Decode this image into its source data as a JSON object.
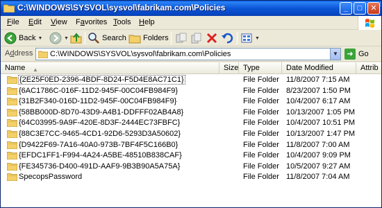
{
  "window": {
    "title": "C:\\WINDOWS\\SYSVOL\\sysvol\\fabrikam.com\\Policies",
    "buttons": {
      "minimize": "_",
      "maximize": "□",
      "close": "✕"
    }
  },
  "menu": {
    "items": [
      {
        "pre": "",
        "key": "F",
        "post": "ile"
      },
      {
        "pre": "",
        "key": "E",
        "post": "dit"
      },
      {
        "pre": "",
        "key": "V",
        "post": "iew"
      },
      {
        "pre": "F",
        "key": "a",
        "post": "vorites"
      },
      {
        "pre": "",
        "key": "T",
        "post": "ools"
      },
      {
        "pre": "",
        "key": "H",
        "post": "elp"
      }
    ]
  },
  "toolbar": {
    "back_label": "Back",
    "search_label": "Search",
    "folders_label": "Folders"
  },
  "address": {
    "label_key": "d",
    "label_pre": "A",
    "label_post": "dress",
    "value": "C:\\WINDOWS\\SYSVOL\\sysvol\\fabrikam.com\\Policies",
    "go_label": "Go"
  },
  "columns": {
    "name": "Name",
    "size": "Size",
    "type": "Type",
    "date": "Date Modified",
    "attrib": "Attrib"
  },
  "files": [
    {
      "name": "{2E25F0ED-2396-4BDF-8D24-F5D4E8AC71C1}",
      "type": "File Folder",
      "date": "11/8/2007 7:15 AM"
    },
    {
      "name": "{6AC1786C-016F-11D2-945F-00C04FB984F9}",
      "type": "File Folder",
      "date": "8/23/2007 1:50 PM"
    },
    {
      "name": "{31B2F340-016D-11D2-945F-00C04FB984F9}",
      "type": "File Folder",
      "date": "10/4/2007 6:17 AM"
    },
    {
      "name": "{58BB000D-8D70-43D9-A4B1-DDFFF02AB4A8}",
      "type": "File Folder",
      "date": "10/13/2007 1:05 PM"
    },
    {
      "name": "{64C03995-9A9F-420E-8D3F-2444EC73FBFC}",
      "type": "File Folder",
      "date": "10/4/2007 10:51 PM"
    },
    {
      "name": "{88C3E7CC-9465-4CD1-92D6-5293D3A50602}",
      "type": "File Folder",
      "date": "10/13/2007 1:47 PM"
    },
    {
      "name": "{D9422F69-7A16-40A0-973B-7BF4F5C166B0}",
      "type": "File Folder",
      "date": "11/8/2007 7:00 AM"
    },
    {
      "name": "{EFDC1FF1-F994-4A24-A5BE-48510B838CAF}",
      "type": "File Folder",
      "date": "10/4/2007 9:09 PM"
    },
    {
      "name": "{FE345736-D400-491D-AAF9-9B3B90A5A75A}",
      "type": "File Folder",
      "date": "10/5/2007 9:27 AM"
    },
    {
      "name": "SpecopsPassword",
      "type": "File Folder",
      "date": "11/8/2007 7:04 AM"
    }
  ]
}
